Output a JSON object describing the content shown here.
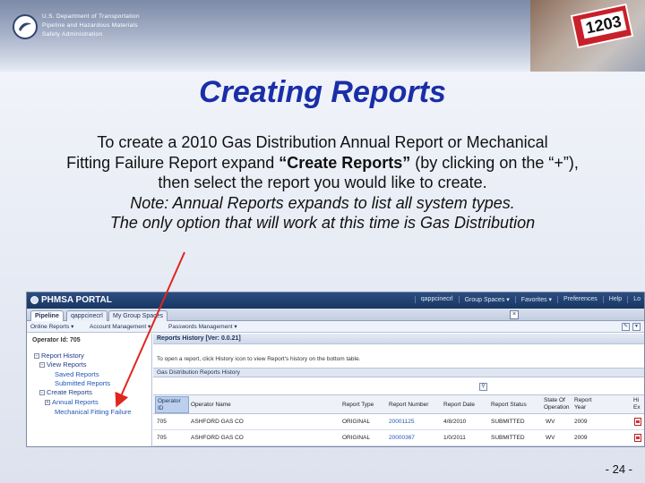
{
  "header": {
    "org_lines": [
      "U.S. Department of Transportation",
      "Pipeline and Hazardous Materials",
      "Safety Administration"
    ],
    "placard_number": "1203"
  },
  "slide": {
    "title": "Creating Reports",
    "line1": "To create a 2010 Gas Distribution Annual Report or Mechanical",
    "line2_pre": "Fitting Failure Report expand ",
    "line2_bold": "“Create Reports”",
    "line2_post": " (by clicking on the “+”),",
    "line3": "then select the report you would like to create.",
    "line4": "Note: Annual Reports expands to list all system types.",
    "line5": "The only option that will work at this time is Gas Distribution",
    "page_number": "- 24 -"
  },
  "portal": {
    "title": "PHMSA PORTAL",
    "menu": [
      "qappcinecrl",
      "Group Spaces ▾",
      "Favorites ▾",
      "Preferences",
      "Help",
      "Lo"
    ],
    "tabs": [
      "Pipeline",
      "qappcinecrl",
      "My Group Spaces"
    ],
    "close_label": "×",
    "toolbar_items": [
      "Online Reports ▾",
      "Account Management ▾",
      "Passwords Management ▾"
    ],
    "toolbar_icons": [
      "✎",
      "▾"
    ]
  },
  "tree": {
    "operator_label": "Operator Id: 705",
    "items": [
      {
        "label": "Report History",
        "expander": "−"
      },
      {
        "label": "View Reports",
        "expander": "−"
      },
      {
        "label": "Saved Reports",
        "expander": ""
      },
      {
        "label": "Submitted Reports",
        "expander": ""
      },
      {
        "label": "Create Reports",
        "expander": "−"
      },
      {
        "label": "Annual Reports",
        "expander": "+"
      },
      {
        "label": "Mechanical Fitting Failure",
        "expander": ""
      }
    ]
  },
  "panel": {
    "header": "Reports History [Ver: 0.0.21]",
    "instructions": "To open a report, click History icon to view Report's history on the bottom table.",
    "subheader": "Gas Distribution Reports History",
    "grid_tool_icon": "⚲",
    "columns": [
      "Operator ID",
      "Operator Name",
      "Report Type",
      "Report Number",
      "Report Date",
      "Report Status",
      "State Of Operation",
      "Report Year",
      "Hi Ex"
    ],
    "rows": [
      [
        "705",
        "ASHFORD GAS CO",
        "ORIGINAL",
        "20001125",
        "4/8/2010",
        "SUBMITTED",
        "WV",
        "2009"
      ],
      [
        "705",
        "ASHFORD GAS CO",
        "ORIGINAL",
        "20000367",
        "1/0/2011",
        "SUBMITTED",
        "WV",
        "2009"
      ]
    ]
  },
  "colors": {
    "title_blue": "#1a2ea8",
    "arrow_red": "#e0261f",
    "portal_bar": "#1f3f70"
  }
}
